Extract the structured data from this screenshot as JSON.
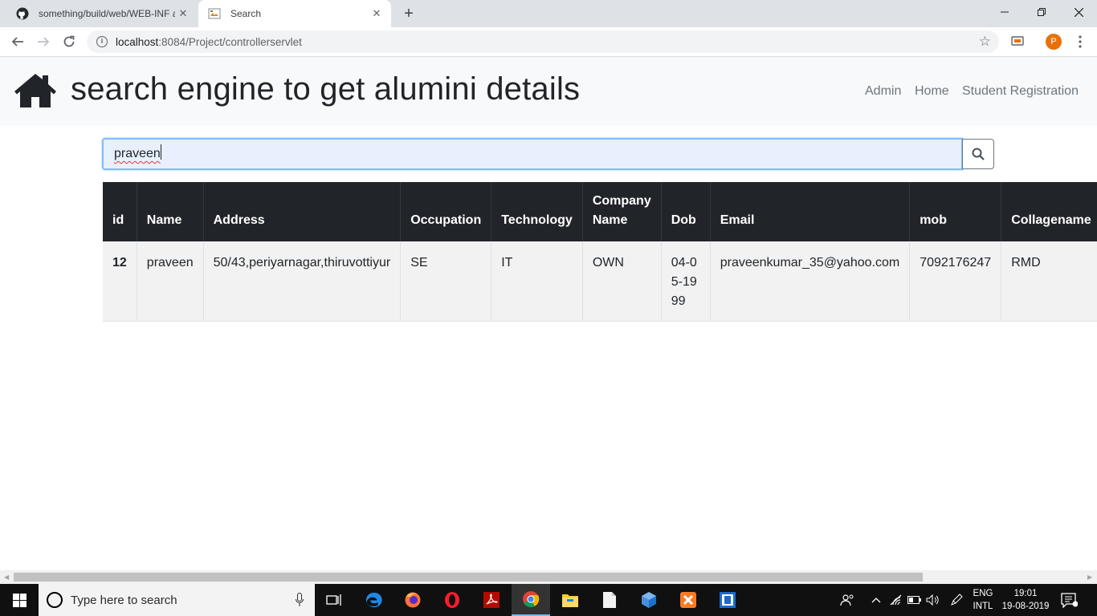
{
  "browser": {
    "tabs": [
      {
        "title": "something/build/web/WEB-INF at",
        "active": false
      },
      {
        "title": "Search",
        "active": true
      }
    ],
    "url_host": "localhost",
    "url_rest": ":8084/Project/controllerservlet",
    "profile_initial": "P"
  },
  "page": {
    "title": "search engine to get alumini details",
    "nav": {
      "admin": "Admin",
      "home": "Home",
      "register": "Student Registration"
    },
    "search": {
      "value": "praveen"
    },
    "table": {
      "headers": [
        "id",
        "Name",
        "Address",
        "Occupation",
        "Technology",
        "Company Name",
        "Dob",
        "Email",
        "mob",
        "Collagename"
      ],
      "rows": [
        {
          "id": "12",
          "name": "praveen",
          "address": "50/43,periyarnagar,thiruvottiyur",
          "occupation": "SE",
          "technology": "IT",
          "company": "OWN",
          "dob": "04-05-1999",
          "email": "praveenkumar_35@yahoo.com",
          "mob": "7092176247",
          "college": "RMD"
        }
      ]
    }
  },
  "taskbar": {
    "search_placeholder": "Type here to search",
    "language": "ENG",
    "layout": "INTL",
    "time": "19:01",
    "date": "19-08-2019",
    "apps": [
      "task-view",
      "edge",
      "firefox",
      "opera",
      "acrobat",
      "chrome",
      "file-explorer",
      "notepad",
      "virtualbox",
      "xampp",
      "netbeans"
    ]
  },
  "colors": {
    "navbar_bg": "#f8f9fa",
    "table_header_bg": "#212529",
    "table_row_bg": "#f2f2f2",
    "search_focus_border": "#80bdff",
    "avatar": "#e8710a"
  }
}
